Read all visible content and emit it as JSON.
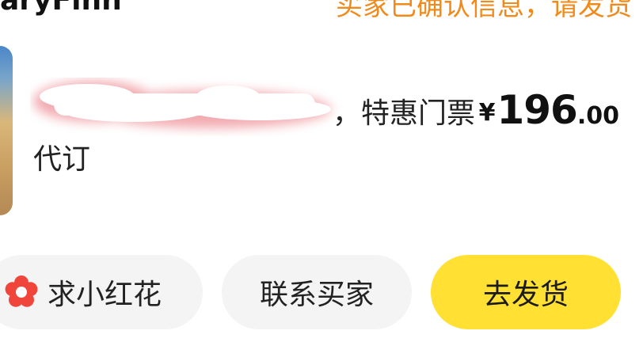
{
  "header": {
    "left_text": "aryFinn",
    "right_notice": "买家已确认信息，请发货"
  },
  "item": {
    "thumbnail_icon": "product-photo-thumbnail",
    "title_line1_tail": "，特惠门票",
    "title_line2": "代订",
    "price": {
      "currency": "¥",
      "integer": "196",
      "decimal": ".00"
    }
  },
  "actions": {
    "flower_label": "求小红花",
    "flower_icon": "red-flower-icon",
    "flower_color": "#f0453a",
    "contact_label": "联系买家",
    "ship_label": "去发货",
    "ship_bg": "#ffe033"
  }
}
